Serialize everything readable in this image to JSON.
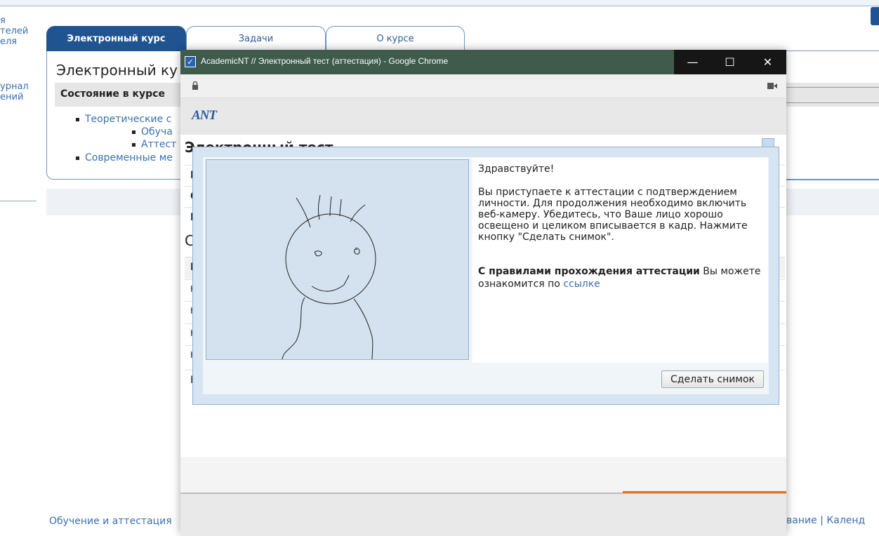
{
  "left_nav": {
    "item1": "я\nтелей\nеля",
    "item2": "урнал\nений"
  },
  "tabs": [
    {
      "label": "Электронный курс"
    },
    {
      "label": "Задачи"
    },
    {
      "label": "О курсе"
    }
  ],
  "course": {
    "heading": "Электронный ку",
    "state_label": "Состояние в курсе",
    "tree": [
      "Теоретические с",
      "Обуча",
      "Аттест",
      "Современные ме"
    ]
  },
  "footer": {
    "left": "Обучение и аттестация",
    "right": "вание | Календ"
  },
  "chrome": {
    "title": "AcademicNT // Электронный тест (аттестация) - Google Chrome",
    "favicon": "checkbox-icon"
  },
  "app": {
    "logo": "ANT",
    "test_title": "Электронный тест",
    "row_letters": [
      "Н",
      "С",
      "Г",
      "С",
      "Н",
      "Н",
      "Н",
      "Н",
      "Н",
      "Н"
    ]
  },
  "modal": {
    "greeting": "Здравствуйте!",
    "text": "Вы приступаете к аттестации с подтверждением личности. Для продолжения необходимо включить веб-камеру. Убедитесь, что Ваше лицо хорошо освещено и целиком вписывается в кадр. Нажмите кнопку \"Сделать снимок\".",
    "rules_bold": "С правилами прохождения аттестации",
    "rules_text": " Вы можете ознакомится по ",
    "rules_link": "ссылке",
    "snap_button": "Сделать снимок"
  }
}
